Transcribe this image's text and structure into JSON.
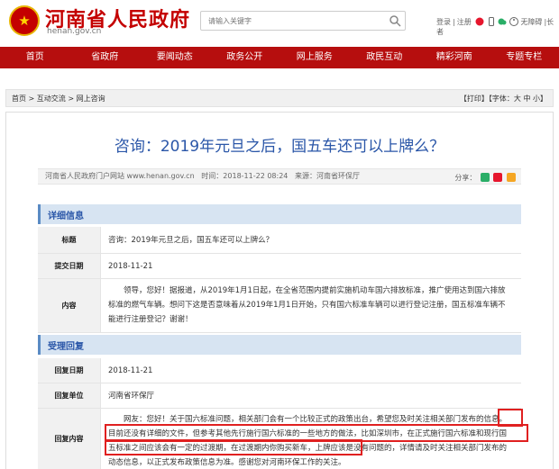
{
  "site": {
    "title": "河南省人民政府",
    "url": "henan.gov.cn"
  },
  "search": {
    "placeholder": "请输入关键字"
  },
  "top_links": {
    "login": "登录",
    "sep": "|",
    "register": "注册",
    "accessibility": "无障碍",
    "elder": "|长者"
  },
  "nav": [
    "首页",
    "省政府",
    "要闻动态",
    "政务公开",
    "网上服务",
    "政民互动",
    "精彩河南",
    "专题专栏"
  ],
  "breadcrumb": {
    "home": "首页",
    "sep1": " > ",
    "level1": "互动交流",
    "sep2": " > ",
    "level2": "网上咨询"
  },
  "tools": {
    "print": "【打印】",
    "font_label": "【字体：",
    "large": "大",
    "medium": "中",
    "small": "小",
    "close": "】"
  },
  "article": {
    "title": "咨询：2019年元旦之后，国五车还可以上牌么？",
    "source": "河南省人民政府门户网站 www.henan.gov.cn",
    "time": "时间：2018-11-22 08:24",
    "origin": "来源：河南省环保厅",
    "share_label": "分享："
  },
  "detail": {
    "section": "详细信息",
    "title_label": "标题",
    "title_value": "咨询：2019年元旦之后，国五车还可以上牌么？",
    "date_label": "提交日期",
    "date_value": "2018-11-21",
    "content_label": "内容",
    "content_value": "领导，您好！据报道，从2019年1月1日起，在全省范围内提前实施机动车国六排放标准，推广使用达到国六排放标准的燃气车辆。想问下这是否意味着从2019年1月1日开始，只有国六标准车辆可以进行登记注册，国五标准车辆不能进行注册登记？谢谢！"
  },
  "reply": {
    "section": "受理回复",
    "date_label": "回复日期",
    "date_value": "2018-11-21",
    "unit_label": "回复单位",
    "unit_value": "河南省环保厅",
    "content_label": "回复内容",
    "content_value": "网友：您好！关于国六标准问题，相关部门会有一个比较正式的政策出台，希望您及时关注相关部门发布的信息。目前还没有详细的文件，但参考其他先行施行国六标准的一些地方的做法，比如深圳市，在正式施行国六标准和现行国五标准之间应该会有一定的过渡期，在过渡期内你购买新车，上牌应该是没有问题的，详情请及时关注相关部门发布的动态信息，以正式发布政策信息为准。感谢您对河南环保工作的关注。"
  },
  "colors": {
    "brand_red": "#b60e0e",
    "title_blue": "#2a56a8",
    "highlight": "#e02020"
  }
}
